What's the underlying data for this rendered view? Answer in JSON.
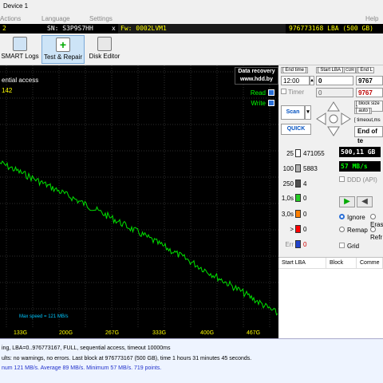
{
  "window": {
    "title": "Device 1"
  },
  "menu": [
    "Actions",
    "Language",
    "Settings",
    "Help"
  ],
  "drive": {
    "model": "2",
    "serial": "SN: S3P9S7HH",
    "close": "x",
    "firmware": "Fw: 0002LVM1",
    "capacity": "976773168 LBA (500 GB)"
  },
  "toolbar": {
    "buttons": [
      {
        "label": "SMART Logs",
        "icon": "smart-logs-icon"
      },
      {
        "label": "Test & Repair",
        "icon": "test-repair-icon"
      },
      {
        "label": "Disk Editor",
        "icon": "disk-editor-icon"
      }
    ]
  },
  "graph": {
    "title": "ential access",
    "subtitle": "142",
    "logo_line1": "Data recovery",
    "logo_line2": "www.hdd.by",
    "read_label": "Read",
    "write_label": "Write",
    "read_checked": true,
    "write_checked": true,
    "max_speed_label": "Max speed = 121 MB/s",
    "x_ticks": [
      "133G",
      "200G",
      "267G",
      "333G",
      "400G",
      "467G"
    ],
    "line_color": "#00e000",
    "start_mbps": 121,
    "end_mbps": 57
  },
  "controls": {
    "end_time_label": "[ End time ]",
    "end_time_value": "12:00",
    "timer_label": "Timer",
    "timer_value": "0",
    "start_lba_label": "[ Start LBA ]",
    "start_lba_cur": "CUR",
    "start_lba_value": "0",
    "start_lba_second": "0",
    "end_lba_label": "[ End L",
    "end_lba_value": "9767",
    "end_lba_second": "9767",
    "block_size_label": "[ block size ]",
    "auto_label": "[ auto ]",
    "timeout_label": "[ timeout,ms",
    "scan_label": "Scan",
    "quick_label": "QUICK",
    "end_of_test": "End of te"
  },
  "counters": [
    {
      "label": "25",
      "value": "471055",
      "color": "#ffffff"
    },
    {
      "label": "100",
      "value": "5883",
      "color": "#b0b0b0"
    },
    {
      "label": "250",
      "value": "4",
      "color": "#505050"
    },
    {
      "label": "1,0s",
      "value": "0",
      "color": "#22cc22"
    },
    {
      "label": "3,0s",
      "value": "0",
      "color": "#ff8000"
    },
    {
      "label": ">",
      "value": "0",
      "color": "#ff0000"
    },
    {
      "label": "Err",
      "value": "0",
      "color": "#2244cc"
    }
  ],
  "stats": {
    "size": "500,11 GB",
    "speed": "57 MB/s",
    "ddd_label": "DDD (API)",
    "ignore_label": "Ignore",
    "erase_label": "Erase",
    "remap_label": "Remap",
    "refresh_label": "Refr",
    "grid_label": "Grid"
  },
  "table": {
    "headers": [
      "Start LBA",
      "Block",
      "Comme"
    ]
  },
  "log": [
    "ing, LBA=0..976773167, FULL, sequential access, timeout 10000ms",
    "ults: no warnings, no errors. Last block at 976773167 (500 GB), time 1 hours 31 minutes 45 seconds.",
    "num 121 MB/s. Average 89 MB/s. Minimum 57 MB/s. 719 points."
  ]
}
